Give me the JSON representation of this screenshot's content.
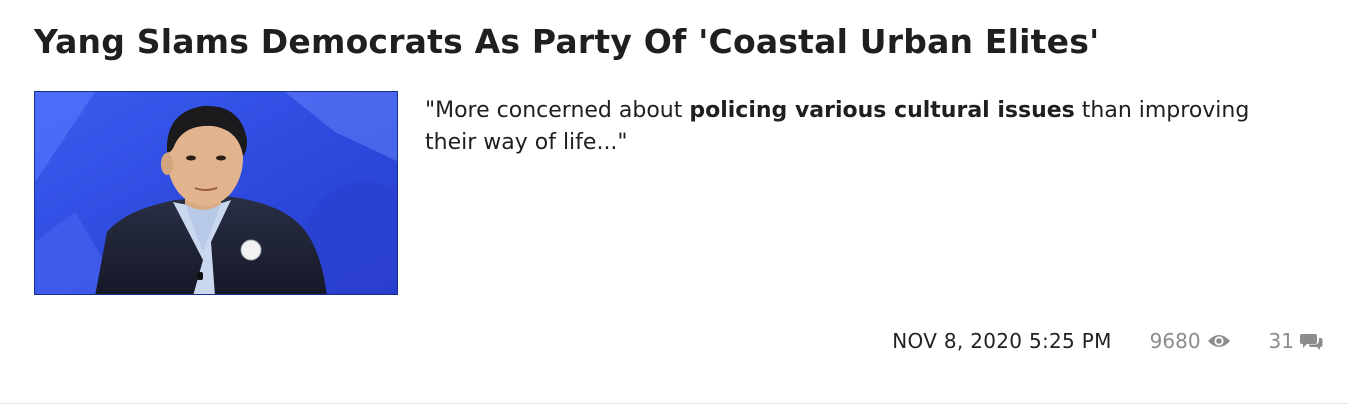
{
  "article": {
    "headline": "Yang Slams Democrats As Party Of 'Coastal Urban Elites'",
    "thumbnail_alt": "Andrew Yang",
    "teaser": {
      "before": "\"More concerned about ",
      "bold": "policing various cultural issues",
      "after": " than improving their way of life...\""
    },
    "meta": {
      "date": "NOV 8, 2020 5:25 PM",
      "views": "9680",
      "comments": "31",
      "views_icon": "eye-icon",
      "comments_icon": "comments-icon"
    }
  },
  "colors": {
    "headline": "#1f1f1f",
    "meta_muted": "#8c8c8c",
    "thumb_bg": "#2f4fe0",
    "divider": "#e4e4e4"
  }
}
